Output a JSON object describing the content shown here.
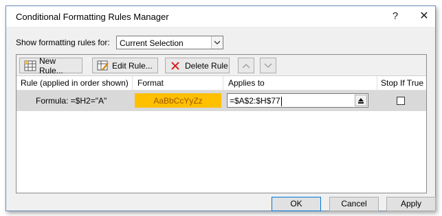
{
  "window": {
    "title": "Conditional Formatting Rules Manager",
    "help_label": "?",
    "close_label": "✕"
  },
  "show_rules": {
    "label": "Show formatting rules for:",
    "selected": "Current Selection"
  },
  "toolbar": {
    "new_rule": "New Rule...",
    "edit_rule": "Edit Rule...",
    "delete_rule": "Delete Rule"
  },
  "table": {
    "columns": [
      "Rule (applied in order shown)",
      "Format",
      "Applies to",
      "Stop If True"
    ],
    "rows": [
      {
        "rule": "Formula: =$H2=\"A\"",
        "format_preview": "AaBbCcYyZz",
        "applies_to": "=$A$2:$H$77",
        "stop_if_true": false
      }
    ]
  },
  "buttons": {
    "ok": "OK",
    "cancel": "Cancel",
    "apply": "Apply"
  },
  "colors": {
    "format_fill": "#ffc000",
    "format_text": "#9c5700",
    "selected_row": "#d9d9d9"
  }
}
